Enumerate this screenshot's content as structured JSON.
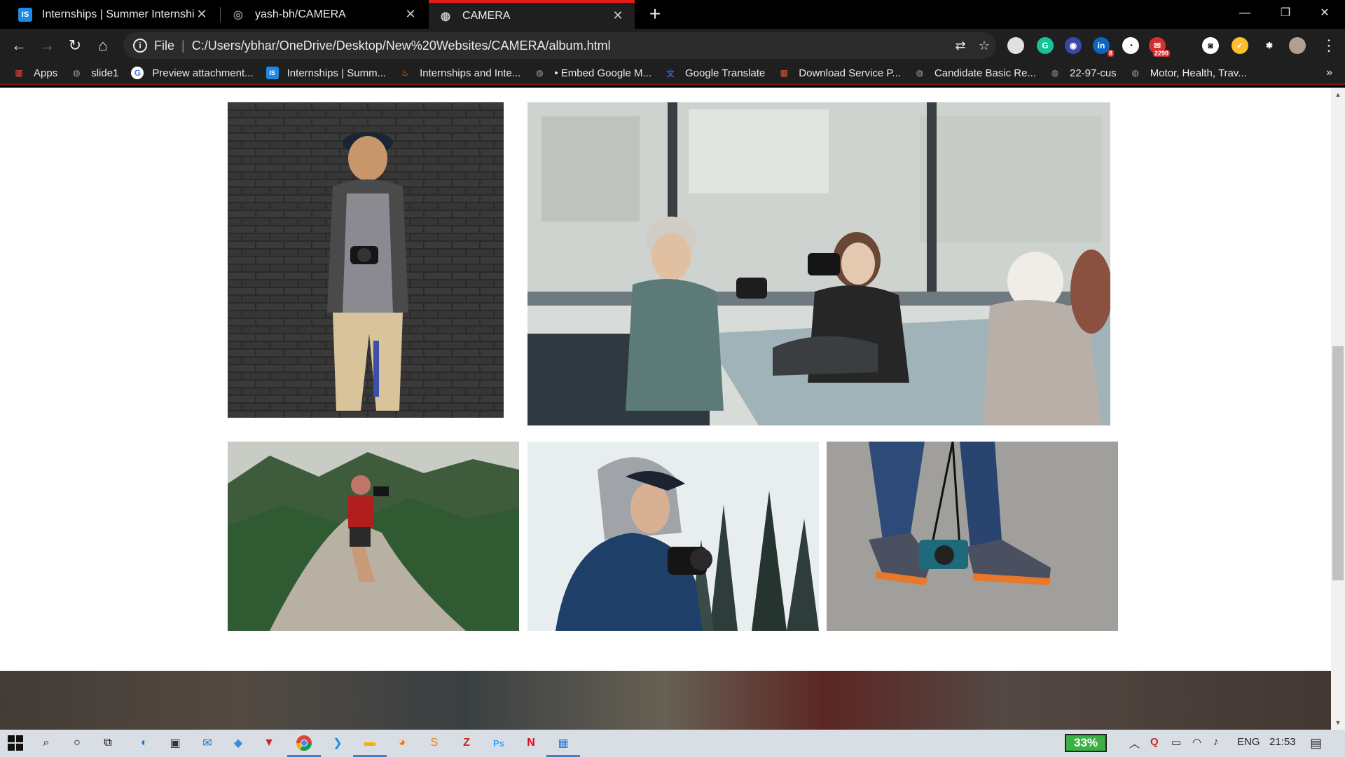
{
  "browser": {
    "tabs": [
      {
        "title": "Internships | Summer Internship",
        "favicon_text": "IS",
        "favicon_color": "#1e88e5"
      },
      {
        "title": "yash-bh/CAMERA",
        "favicon_text": "◎",
        "favicon_color": "#000000"
      },
      {
        "title": "CAMERA",
        "favicon_text": "◍",
        "favicon_color": "#1f1f1f"
      }
    ],
    "active_tab": 2,
    "address": {
      "scheme_label": "File",
      "url": "C:/Users/ybhar/OneDrive/Desktop/New%20Websites/CAMERA/album.html"
    },
    "extensions": [
      {
        "name": "circle-extension-icon",
        "color": "#e0e0e0",
        "text": ""
      },
      {
        "name": "grammarly-icon",
        "color": "#15c39a",
        "text": "G"
      },
      {
        "name": "ext-owl-icon",
        "color": "#3949ab",
        "text": "◉"
      },
      {
        "name": "linkedin-icon",
        "color": "#0a66c2",
        "text": "in",
        "badge": "8"
      },
      {
        "name": "speed-icon",
        "color": "#ffffff",
        "text": "◔"
      },
      {
        "name": "mail-counter-icon",
        "color": "#d32f2f",
        "text": "✉",
        "badge": "2290"
      },
      {
        "name": "instagram-icon",
        "color": "#ffffff",
        "text": "◙"
      },
      {
        "name": "palette-icon",
        "color": "#fbc02d",
        "text": "✓"
      },
      {
        "name": "puzzle-icon",
        "color": "#1f1f1f",
        "text": "✱"
      },
      {
        "name": "profile-avatar",
        "color": "#b0a090",
        "text": ""
      }
    ]
  },
  "bookmarks": [
    {
      "label": "Apps",
      "icon": "apps-grid-icon",
      "color": "#ea4335"
    },
    {
      "label": "slide1",
      "icon": "globe-icon",
      "color": "#9e9e9e"
    },
    {
      "label": "Preview attachment...",
      "icon": "google-icon",
      "color": "#ffffff"
    },
    {
      "label": "Internships | Summ...",
      "icon": "is-icon",
      "color": "#1e88e5"
    },
    {
      "label": "Internships and Inte...",
      "icon": "flame-icon",
      "color": "#f57c00"
    },
    {
      "label": "• Embed Google M...",
      "icon": "globe-icon",
      "color": "#9e9e9e"
    },
    {
      "label": "Google Translate",
      "icon": "translate-icon",
      "color": "#4285f4"
    },
    {
      "label": "Download Service P...",
      "icon": "microsoft-icon",
      "color": "#f25022"
    },
    {
      "label": "Candidate Basic Re...",
      "icon": "globe-icon",
      "color": "#9e9e9e"
    },
    {
      "label": "22-97-cus",
      "icon": "globe-icon",
      "color": "#9e9e9e"
    },
    {
      "label": "Motor, Health, Trav...",
      "icon": "globe-icon",
      "color": "#9e9e9e"
    }
  ],
  "album": {
    "photos": [
      {
        "name": "photo-man-brick-wall"
      },
      {
        "name": "photo-women-cafe-cameras"
      },
      {
        "name": "photo-mountain-cliff"
      },
      {
        "name": "photo-hoodie-camera"
      },
      {
        "name": "photo-sneakers-camera"
      }
    ]
  },
  "taskbar": {
    "battery_percent": "33%",
    "language": "ENG",
    "time": "21:53"
  }
}
